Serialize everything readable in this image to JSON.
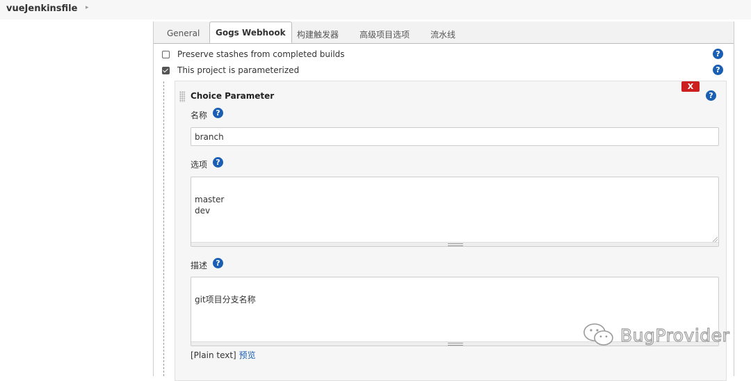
{
  "header": {
    "breadcrumb": "vueJenkinsfile"
  },
  "tabs": [
    {
      "label": "General"
    },
    {
      "label": "Gogs Webhook"
    },
    {
      "label": "构建触发器"
    },
    {
      "label": "高级项目选项"
    },
    {
      "label": "流水线"
    }
  ],
  "options": {
    "preserve_stashes": {
      "label": "Preserve stashes from completed builds",
      "checked": false
    },
    "parameterized": {
      "label": "This project is parameterized",
      "checked": true
    }
  },
  "parameter": {
    "title": "Choice Parameter",
    "delete_label": "X",
    "name_label": "名称",
    "name_value": "branch",
    "choices_label": "选项",
    "choices_value": "master\ndev",
    "description_label": "描述",
    "description_value": "git项目分支名称",
    "format_hint": "[Plain text]",
    "preview_label": "预览"
  },
  "help_icon_glyph": "?",
  "watermark": {
    "text": "BugProvider"
  },
  "colors": {
    "accent": "#1b5fb4",
    "danger": "#cc1f1f"
  }
}
